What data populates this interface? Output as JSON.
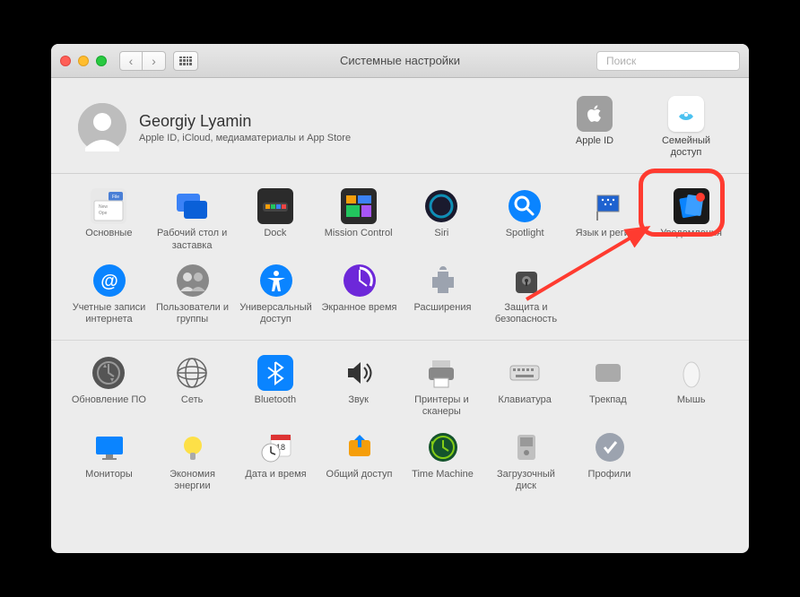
{
  "titlebar": {
    "window_title": "Системные настройки",
    "search_placeholder": "Поиск"
  },
  "account": {
    "name": "Georgiy Lyamin",
    "subtitle": "Apple ID, iCloud, медиаматериалы и App Store",
    "apple_id_label": "Apple ID",
    "family_label": "Семейный доступ"
  },
  "section1": {
    "row1": [
      {
        "label": "Основные"
      },
      {
        "label": "Рабочий стол и заставка"
      },
      {
        "label": "Dock"
      },
      {
        "label": "Mission Control"
      },
      {
        "label": "Siri"
      },
      {
        "label": "Spotlight"
      },
      {
        "label": "Язык и регион"
      },
      {
        "label": "Уведомления"
      }
    ],
    "row2": [
      {
        "label": "Учетные записи интернета"
      },
      {
        "label": "Пользователи и группы"
      },
      {
        "label": "Универсальный доступ"
      },
      {
        "label": "Экранное время"
      },
      {
        "label": "Расширения"
      },
      {
        "label": "Защита и безопасность"
      }
    ]
  },
  "section2": {
    "row1": [
      {
        "label": "Обновление ПО"
      },
      {
        "label": "Сеть"
      },
      {
        "label": "Bluetooth"
      },
      {
        "label": "Звук"
      },
      {
        "label": "Принтеры и сканеры"
      },
      {
        "label": "Клавиатура"
      },
      {
        "label": "Трекпад"
      },
      {
        "label": "Мышь"
      }
    ],
    "row2": [
      {
        "label": "Мониторы"
      },
      {
        "label": "Экономия энергии"
      },
      {
        "label": "Дата и время"
      },
      {
        "label": "Общий доступ"
      },
      {
        "label": "Time Machine"
      },
      {
        "label": "Загрузочный диск"
      },
      {
        "label": "Профили"
      }
    ]
  },
  "colors": {
    "accent_blue": "#0a84ff",
    "annotation_red": "#ff3b30"
  }
}
